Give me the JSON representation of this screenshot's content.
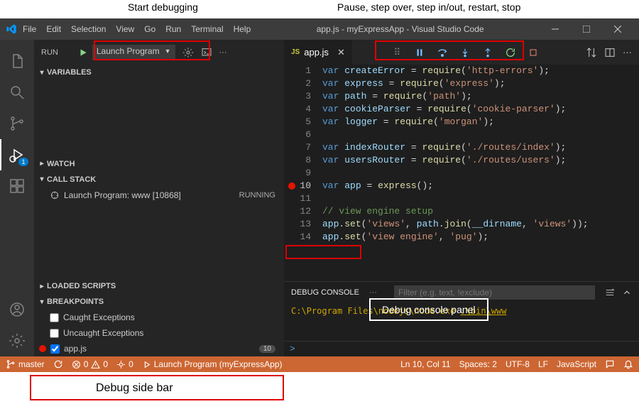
{
  "annotations": {
    "start": "Start debugging",
    "toolbar": "Pause, step over, step in/out, restart, stop",
    "sidebar": "Debug side bar",
    "console": "Debug console panel"
  },
  "window": {
    "title": "app.js - myExpressApp - Visual Studio Code"
  },
  "menu": [
    "File",
    "Edit",
    "Selection",
    "View",
    "Go",
    "Run",
    "Terminal",
    "Help"
  ],
  "activity": {
    "debug_badge": "1"
  },
  "sidebar": {
    "title": "RUN",
    "launch_config": "Launch Program",
    "sections": {
      "variables": "VARIABLES",
      "watch": "WATCH",
      "callstack": "CALL STACK",
      "loaded": "LOADED SCRIPTS",
      "breakpoints": "BREAKPOINTS"
    },
    "callstack_item": {
      "label": "Launch Program: www [10868]",
      "status": "RUNNING"
    },
    "breakpoints": {
      "caught": "Caught Exceptions",
      "uncaught": "Uncaught Exceptions",
      "file": "app.js",
      "file_count": "10"
    }
  },
  "editor": {
    "tab": {
      "lang": "JS",
      "name": "app.js"
    },
    "lines": [
      {
        "n": 1,
        "k": "var",
        "id": "createError",
        "fn": "require",
        "s": "'http-errors'"
      },
      {
        "n": 2,
        "k": "var",
        "id": "express",
        "fn": "require",
        "s": "'express'"
      },
      {
        "n": 3,
        "k": "var",
        "id": "path",
        "fn": "require",
        "s": "'path'"
      },
      {
        "n": 4,
        "k": "var",
        "id": "cookieParser",
        "fn": "require",
        "s": "'cookie-parser'"
      },
      {
        "n": 5,
        "k": "var",
        "id": "logger",
        "fn": "require",
        "s": "'morgan'"
      },
      {
        "n": 6,
        "blank": true
      },
      {
        "n": 7,
        "k": "var",
        "id": "indexRouter",
        "fn": "require",
        "s": "'./routes/index'"
      },
      {
        "n": 8,
        "k": "var",
        "id": "usersRouter",
        "fn": "require",
        "s": "'./routes/users'"
      },
      {
        "n": 9,
        "blank": true
      },
      {
        "n": 10,
        "bp": true,
        "cur": true,
        "k": "var",
        "id": "app",
        "fn": "express",
        "call": true
      },
      {
        "n": 11,
        "blank": true
      },
      {
        "n": 12,
        "cm": "// view engine setup"
      },
      {
        "n": 13,
        "raw": "app.set('views', path.join(__dirname, 'views'));",
        "id": "app",
        "fn": "set",
        "s1": "'views'",
        "s2": "'views'",
        "id2": "path",
        "fn2": "join",
        "id3": "__dirname"
      },
      {
        "n": 14,
        "partial": true,
        "id": "app",
        "fn": "set",
        "s1": "'view engine'",
        "s2": "'pug'"
      }
    ]
  },
  "panel": {
    "tab": "DEBUG CONSOLE",
    "filter_placeholder": "Filter (e.g. text, !exclude)",
    "output": {
      "pre": "C:\\Program Files\\nodejs\\node.exe ",
      "link": ".\\bin\\www"
    }
  },
  "status": {
    "branch": "master",
    "errors": "0",
    "warnings": "0",
    "port": "0",
    "launch": "Launch Program (myExpressApp)",
    "pos": "Ln 10, Col 11",
    "spaces": "Spaces: 2",
    "enc": "UTF-8",
    "eol": "LF",
    "lang": "JavaScript"
  }
}
